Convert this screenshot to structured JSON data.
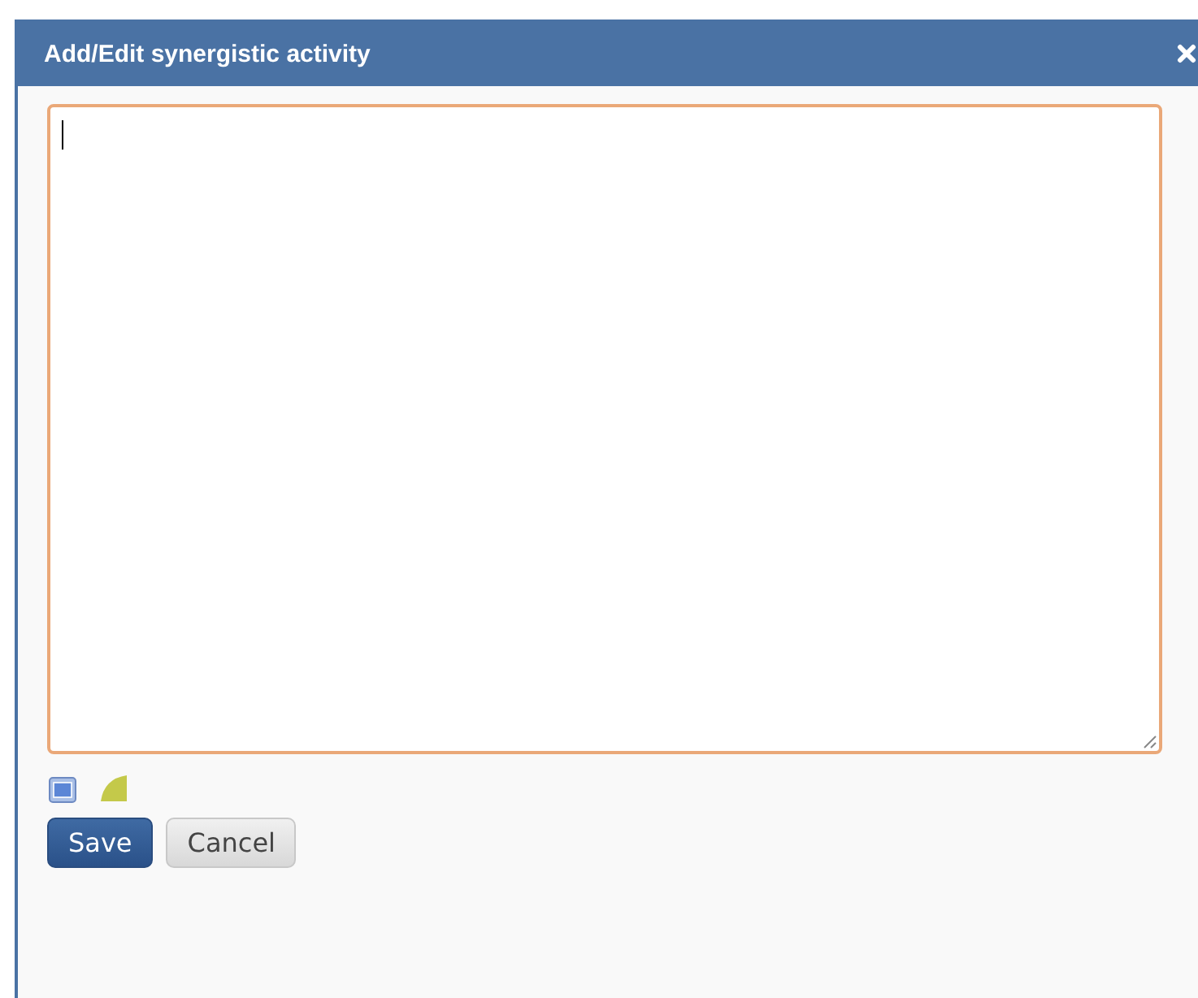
{
  "dialog": {
    "title": "Add/Edit synergistic activity"
  },
  "editor": {
    "focused": true
  },
  "buttons": [
    {
      "label": "Save",
      "kind": "primary"
    },
    {
      "label": "Cancel",
      "kind": "secondary"
    }
  ]
}
